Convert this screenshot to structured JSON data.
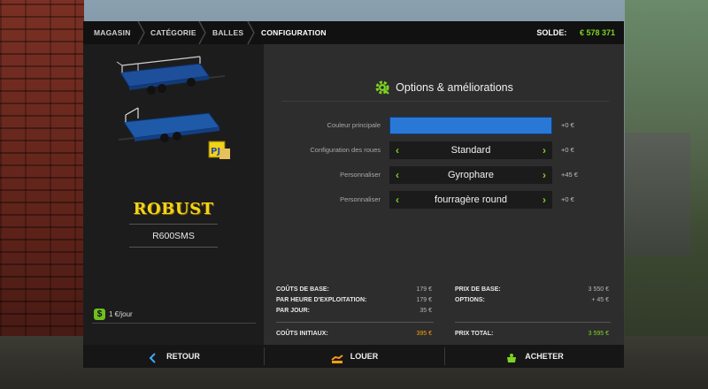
{
  "breadcrumb": [
    "MAGASIN",
    "CATÉGORIE",
    "BALLES",
    "CONFIGURATION"
  ],
  "balance": {
    "label": "SOLDE:",
    "value": "€ 578 371"
  },
  "vehicle": {
    "brand": "ROBUST",
    "model": "R600SMS",
    "upkeep": "1 €/jour"
  },
  "options": {
    "title": "Options & améliorations",
    "rows": [
      {
        "label": "Couleur principale",
        "value": "",
        "price": "+0 €",
        "swatch": "#2a78d6"
      },
      {
        "label": "Configuration des roues",
        "value": "Standard",
        "price": "+0 €"
      },
      {
        "label": "Personnaliser",
        "value": "Gyrophare",
        "price": "+45 €"
      },
      {
        "label": "Personnaliser",
        "value": "fourragère round",
        "price": "+0 €"
      }
    ]
  },
  "costs": {
    "base_label": "COÛTS DE BASE:",
    "base_value": "179 €",
    "hour_label": "PAR HEURE D'EXPLOITATION:",
    "hour_value": "179 €",
    "day_label": "PAR JOUR:",
    "day_value": "35 €",
    "initial_label": "COÛTS INITIAUX:",
    "initial_value": "395 €",
    "base_price_label": "PRIX DE BASE:",
    "base_price_value": "3 550 €",
    "options_label": "OPTIONS:",
    "options_value": "+ 45 €",
    "total_label": "PRIX TOTAL:",
    "total_value": "3 595 €"
  },
  "actions": {
    "back": "RETOUR",
    "lease": "LOUER",
    "buy": "ACHETER"
  },
  "colors": {
    "accent": "#7ed321",
    "brand": "#f3d21a",
    "initial": "#f39c12"
  }
}
